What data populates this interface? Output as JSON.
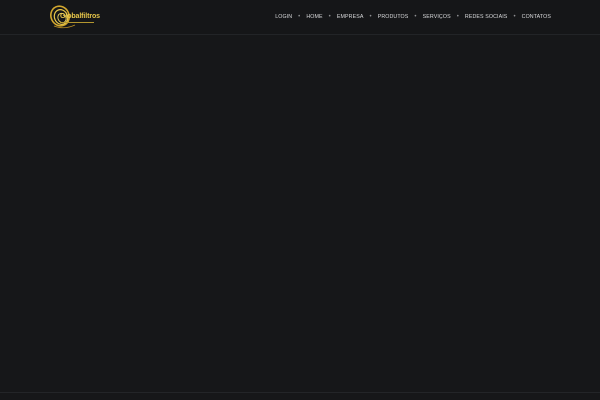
{
  "brand": {
    "name": "Globalfiltros",
    "icon": "globe-orbit-logo-icon",
    "color": "#e7c64a"
  },
  "nav": {
    "items": [
      {
        "label": "LOGIN"
      },
      {
        "label": "HOME"
      },
      {
        "label": "EMPRESA"
      },
      {
        "label": "PRODUTOS"
      },
      {
        "label": "SERVIÇOS"
      },
      {
        "label": "REDES SOCIAIS"
      },
      {
        "label": "CONTATOS"
      }
    ],
    "separator": "•"
  },
  "colors": {
    "background": "#161719",
    "nav_text": "#d9dadc",
    "accent": "#e7c64a"
  }
}
